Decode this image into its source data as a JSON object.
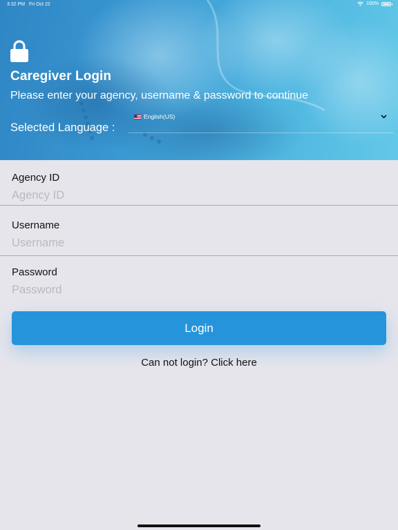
{
  "status_bar": {
    "time": "3:32 PM",
    "date": "Fri Oct 22",
    "battery_text": "100%",
    "battery_level": 1.0
  },
  "header": {
    "title": "Caregiver Login",
    "subtitle": "Please enter your agency, username & password to continue",
    "language_label": "Selected Language :",
    "language_value": "English(US)"
  },
  "form": {
    "agency": {
      "label": "Agency ID",
      "placeholder": "Agency ID",
      "value": ""
    },
    "username": {
      "label": "Username",
      "placeholder": "Username",
      "value": ""
    },
    "password": {
      "label": "Password",
      "placeholder": "Password",
      "value": ""
    },
    "login_label": "Login",
    "help_text": "Can not login? Click here"
  },
  "icons": {
    "lock": "lock-icon",
    "flag": "us-flag-icon",
    "chevron": "chevron-down-icon",
    "wifi": "wifi-icon",
    "battery": "battery-icon"
  },
  "colors": {
    "accent": "#2694da",
    "background": "#e6e5ec",
    "header": "#3a98d2"
  }
}
